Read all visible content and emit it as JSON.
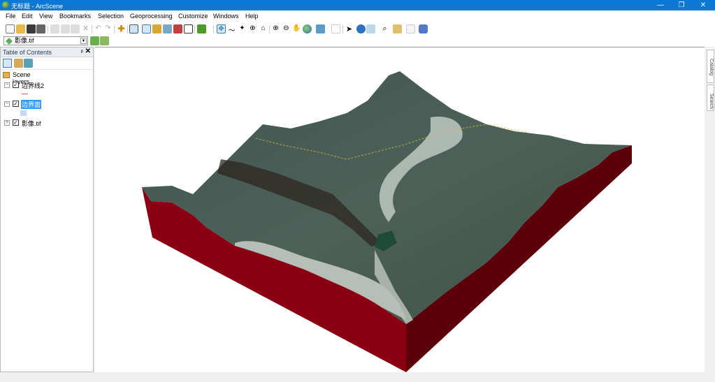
{
  "window": {
    "title": "无标题 - ArcScene",
    "controls": {
      "minimize": "—",
      "restore": "❐",
      "close": "✕"
    }
  },
  "menu": [
    "File",
    "Edit",
    "View",
    "Bookmarks",
    "Selection",
    "Geoprocessing",
    "Customize",
    "Windows",
    "Help"
  ],
  "toolbar": {
    "standard_icons": [
      "new-document-icon",
      "open-folder-icon",
      "save-icon",
      "print-icon",
      "cut-icon",
      "copy-icon",
      "paste-icon",
      "delete-icon",
      "undo-icon",
      "redo-icon",
      "add-data-icon",
      "arcmap-icon",
      "toc-icon",
      "catalog-icon",
      "toolbox-icon",
      "python-icon",
      "window-icon",
      "model-icon"
    ],
    "navigate_icons": [
      "navigate-icon",
      "fly-icon",
      "center-target-icon",
      "zoom-target-icon",
      "set-observer-icon",
      "zoom-in-icon",
      "zoom-out-icon",
      "pan-hand-icon",
      "full-extent-icon",
      "view-menu-icon",
      "selection-box-icon",
      "select-arrow-icon",
      "identify-icon",
      "html-popup-icon",
      "find-icon",
      "measure-icon",
      "animation-icon",
      "3d-effects-icon"
    ],
    "layer_select": {
      "value": "影像.tif"
    }
  },
  "toc": {
    "title": "Table of Contents",
    "pin": "ᵖ",
    "close": "✕",
    "root": "Scene layers",
    "layers": [
      {
        "name": "边界线2",
        "checked": true,
        "expanded": true,
        "symbol": "line",
        "symbol_color": "#e05050"
      },
      {
        "name": "边界面",
        "checked": true,
        "expanded": true,
        "selected": true,
        "symbol": "polygon",
        "symbol_color": "#c5d9f1"
      },
      {
        "name": "影像.tif",
        "checked": true,
        "expanded": false
      }
    ]
  },
  "scene": {
    "description": "3D terrain block with draped satellite imagery",
    "side_color": "#7a0010",
    "side_dark_color": "#4a0008"
  },
  "dock_tabs": [
    "Catalog",
    "Search"
  ]
}
